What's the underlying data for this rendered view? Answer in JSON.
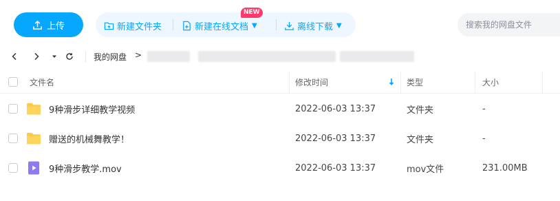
{
  "toolbar": {
    "upload_label": "上传",
    "new_folder_label": "新建文件夹",
    "new_online_doc_label": "新建在线文档",
    "new_badge": "NEW",
    "offline_download_label": "离线下载",
    "search_placeholder": "搜索我的网盘文件",
    "accent_color": "#06a7ff"
  },
  "nav": {
    "root_label": "我的网盘",
    "separator": ">"
  },
  "table": {
    "headers": {
      "name": "文件名",
      "modified": "修改时间",
      "type": "类型",
      "size": "大小"
    },
    "rows": [
      {
        "icon": "folder-icon",
        "name": "9种滑步详细教学视频",
        "modified": "2022-06-03 13:37",
        "type": "文件夹",
        "size": "-"
      },
      {
        "icon": "folder-icon",
        "name": "赠送的机械舞教学！",
        "modified": "2022-06-03 13:37",
        "type": "文件夹",
        "size": "-"
      },
      {
        "icon": "video-file-icon",
        "name": "9种滑步教学.mov",
        "modified": "2022-06-03 13:37",
        "type": "mov文件",
        "size": "231.00MB"
      }
    ]
  }
}
